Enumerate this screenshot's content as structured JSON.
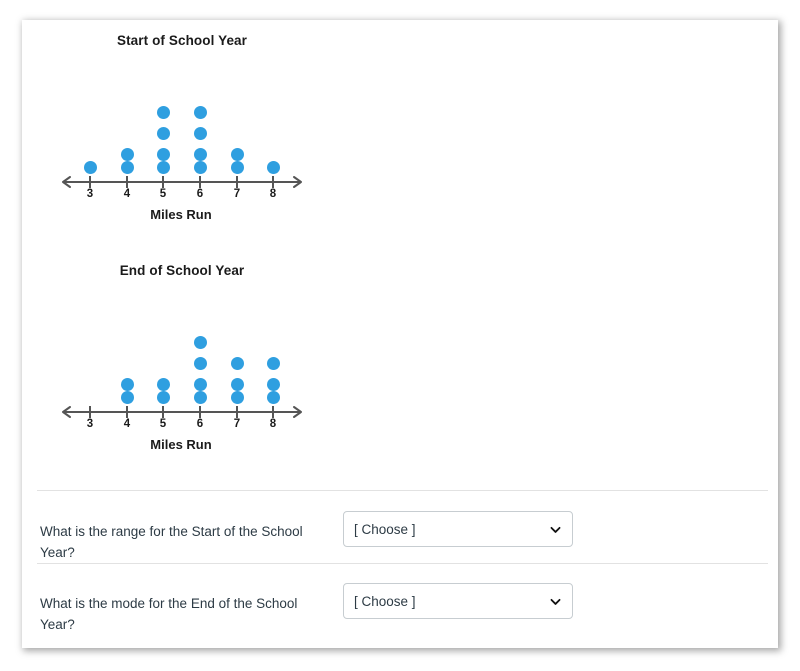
{
  "theme": {
    "dot_color": "#2f9fe0",
    "axis_color": "#555555",
    "text_color": "#2d3b45",
    "divider_color": "#e2e2e2",
    "card_background": "#ffffff"
  },
  "chart_data": [
    {
      "type": "dotplot",
      "title": "Start of School Year",
      "xlabel": "Miles Run",
      "ylabel": "",
      "categories": [
        "3",
        "4",
        "5",
        "6",
        "7",
        "8"
      ],
      "values": [
        1,
        2,
        4,
        4,
        2,
        1
      ],
      "xlim": [
        3,
        8
      ],
      "grid": false,
      "legend": "none",
      "tick_labels": [
        "3",
        "4",
        "5",
        "6",
        "7",
        "8"
      ]
    },
    {
      "type": "dotplot",
      "title": "End of School Year",
      "xlabel": "Miles Run",
      "ylabel": "",
      "categories": [
        "3",
        "4",
        "5",
        "6",
        "7",
        "8"
      ],
      "values": [
        0,
        2,
        2,
        4,
        3,
        3
      ],
      "xlim": [
        3,
        8
      ],
      "grid": false,
      "legend": "none",
      "tick_labels": [
        "3",
        "4",
        "5",
        "6",
        "7",
        "8"
      ]
    }
  ],
  "questions": [
    {
      "prompt": "What is the range for the Start of the School Year?",
      "select_value": "[ Choose ]",
      "icon": "chevron-down-icon"
    },
    {
      "prompt": "What is the mode for the End of the School Year?",
      "select_value": "[ Choose ]",
      "icon": "chevron-down-icon"
    }
  ]
}
